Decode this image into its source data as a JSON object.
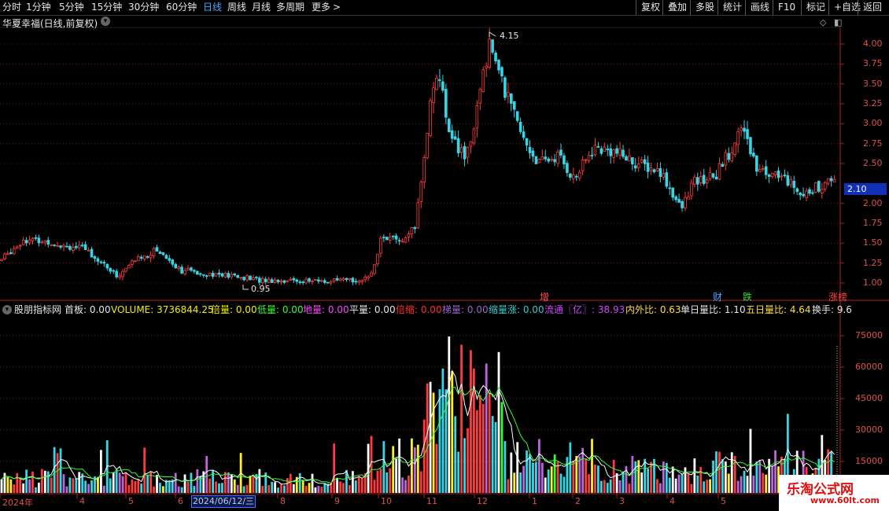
{
  "toolbar": {
    "periods": [
      "分时",
      "1分钟",
      "5分钟",
      "15分钟",
      "30分钟",
      "60分钟",
      "日线",
      "周线",
      "月线",
      "多周期",
      "更多"
    ],
    "active_period": "日线",
    "more_arrow": ">",
    "actions": [
      "复权",
      "叠加",
      "多股",
      "统计",
      "画线",
      "F10",
      "标记",
      "+自选",
      "返回"
    ]
  },
  "main_panel": {
    "title": "华夏幸福(日线,前复权)",
    "y_ticks": [
      "4.00",
      "3.75",
      "3.50",
      "3.25",
      "3.00",
      "2.75",
      "2.50",
      "2.00",
      "1.75",
      "1.50",
      "1.25",
      "1.00"
    ],
    "current_price": "2.10",
    "high_label": "4.15",
    "low_label": "0.95",
    "events": [
      {
        "text": "增",
        "color": "#ff5050"
      },
      {
        "text": "财",
        "color": "#4aa3ff"
      },
      {
        "text": "跌",
        "color": "#33dd33"
      },
      {
        "text": "涨榜",
        "color": "#ff4040"
      }
    ]
  },
  "indicator_panel": {
    "name": "股朋指标网",
    "items": [
      {
        "label": "首板:",
        "value": "0.00",
        "color": "#e6e6e6"
      },
      {
        "label": "VOLUME:",
        "value": "3736844.25",
        "color": "#f0f000"
      },
      {
        "label": "倍量:",
        "value": "0.00",
        "color": "#f0f000"
      },
      {
        "label": "低量:",
        "value": "0.00",
        "color": "#33ff33"
      },
      {
        "label": "地量:",
        "value": "0.00",
        "color": "#ff44ff"
      },
      {
        "label": "平量:",
        "value": "0.00",
        "color": "#e6e6e6"
      },
      {
        "label": "倍缩:",
        "value": "0.00",
        "color": "#ff3030"
      },
      {
        "label": "梯量:",
        "value": "0.00",
        "color": "#9966cc"
      },
      {
        "label": "缩量涨:",
        "value": "0.00",
        "color": "#33cccc"
      },
      {
        "label": "流通〖亿〗:",
        "value": "38.93",
        "color": "#cc44ff"
      },
      {
        "label": "内外比:",
        "value": "0.63",
        "color": "#ffdd44"
      },
      {
        "label": "单日量比:",
        "value": "1.10",
        "color": "#e6e6e6"
      },
      {
        "label": "五日量比:",
        "value": "4.64",
        "color": "#ffdd44"
      },
      {
        "label": "换手:",
        "value": "9.6",
        "color": "#e6e6e6"
      }
    ],
    "y_ticks": [
      "75000",
      "60000",
      "45000",
      "30000",
      "15000"
    ]
  },
  "date_axis": {
    "labels": [
      "2024年",
      "4",
      "5",
      "6",
      "8",
      "9",
      "10",
      "11",
      "12",
      "1",
      "2",
      "3",
      "4",
      "5"
    ],
    "cursor_date": "2024/06/12/三"
  },
  "watermark": {
    "title": "乐淘公式网",
    "url": "www.60lt.com"
  }
}
